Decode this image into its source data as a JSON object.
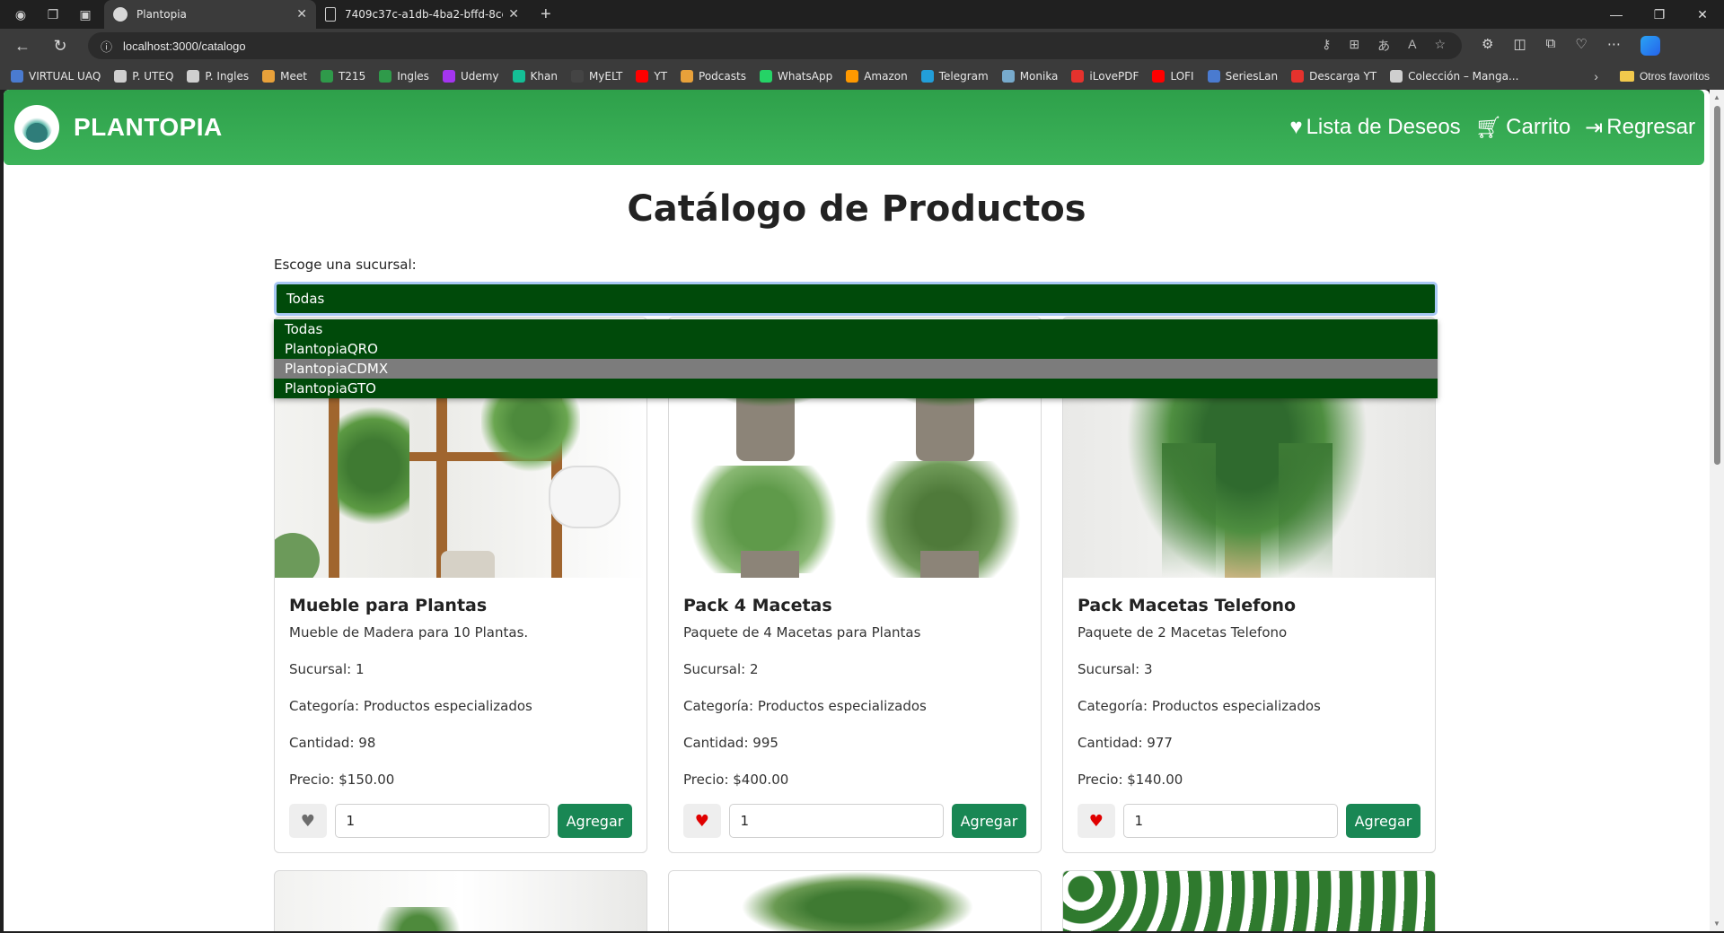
{
  "browser": {
    "tabs": [
      {
        "title": "Plantopia",
        "active": true
      },
      {
        "title": "7409c37c-a1db-4ba2-bffd-8cedc",
        "active": false
      }
    ],
    "url": "localhost:3000/catalogo",
    "bookmarks": [
      "VIRTUAL UAQ",
      "P. UTEQ",
      "P. Ingles",
      "Meet",
      "T215",
      "Ingles",
      "Udemy",
      "Khan",
      "MyELT",
      "YT",
      "Podcasts",
      "WhatsApp",
      "Amazon",
      "Telegram",
      "Monika",
      "iLovePDF",
      "LOFI",
      "SeriesLan",
      "Descarga YT",
      "Colección – Manga..."
    ],
    "other_favorites": "Otros favoritos"
  },
  "navbar": {
    "brand": "PLANTOPIA",
    "wishlist": "Lista de Deseos",
    "cart": "Carrito",
    "back": "Regresar"
  },
  "page": {
    "title": "Catálogo de Productos",
    "select_label": "Escoge una sucursal:",
    "select_value": "Todas",
    "options": [
      "Todas",
      "PlantopiaQRO",
      "PlantopiaCDMX",
      "PlantopiaGTO"
    ],
    "highlighted_option": "PlantopiaCDMX"
  },
  "products": [
    {
      "name": "Mueble para Plantas",
      "description": "Mueble de Madera para 10 Plantas.",
      "sucursal": "Sucursal: 1",
      "categoria": "Categoría: Productos especializados",
      "cantidad": "Cantidad: 98",
      "precio": "Precio: $150.00",
      "qty": "1",
      "add_label": "Agregar",
      "favorite": false
    },
    {
      "name": "Pack 4 Macetas",
      "description": "Paquete de 4 Macetas para Plantas",
      "sucursal": "Sucursal: 2",
      "categoria": "Categoría: Productos especializados",
      "cantidad": "Cantidad: 995",
      "precio": "Precio: $400.00",
      "qty": "1",
      "add_label": "Agregar",
      "favorite": true
    },
    {
      "name": "Pack Macetas Telefono",
      "description": "Paquete de 2 Macetas Telefono",
      "sucursal": "Sucursal: 3",
      "categoria": "Categoría: Productos especializados",
      "cantidad": "Cantidad: 977",
      "precio": "Precio: $140.00",
      "qty": "1",
      "add_label": "Agregar",
      "favorite": true
    }
  ],
  "colors": {
    "brand_green": "#3cb35a",
    "select_bg": "#004a0a",
    "button_green": "#198754",
    "heart_active": "#e00000",
    "heart_inactive": "#6c6c6c"
  }
}
